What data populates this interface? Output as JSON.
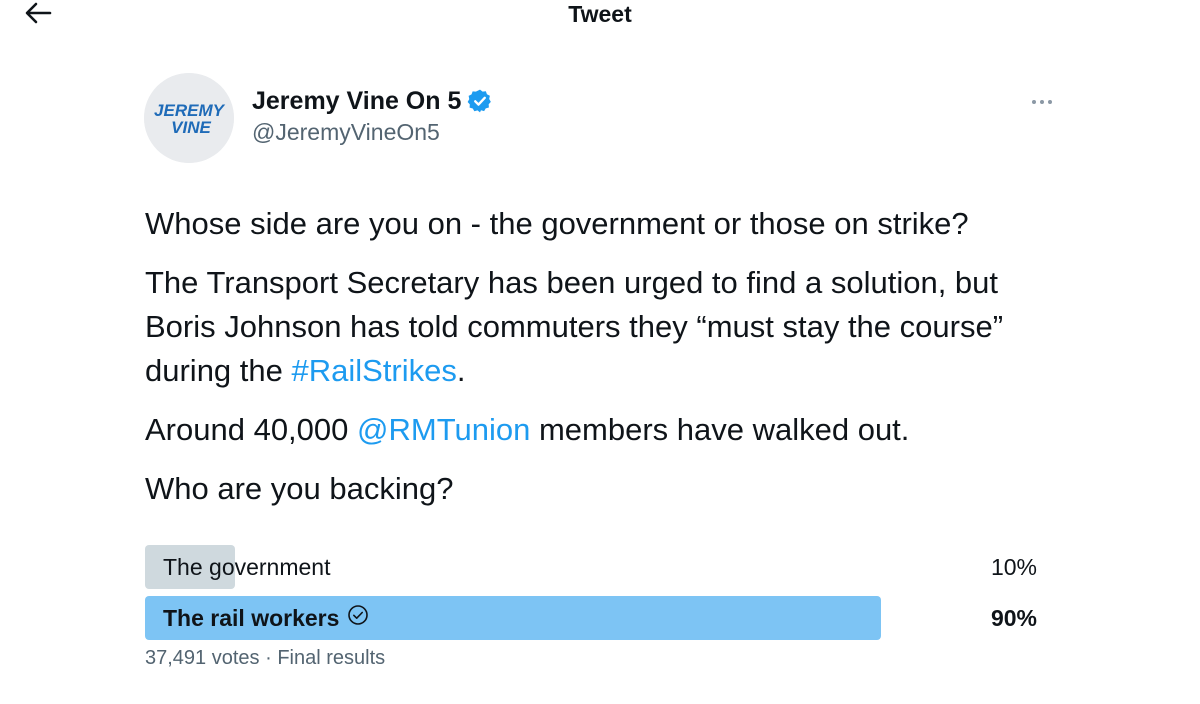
{
  "header": {
    "title": "Tweet"
  },
  "author": {
    "display_name": "Jeremy Vine On 5",
    "handle": "@JeremyVineOn5",
    "avatar_text_line1": "JEREMY",
    "avatar_text_line2": "VINE",
    "verified": true,
    "verified_color": "#1d9bf0"
  },
  "tweet": {
    "p1": "Whose side are you on - the government or those on strike?",
    "p2_pre": "The Transport Secretary has been urged to find a solution, but Boris Johnson has told commuters they “must stay the course” during the ",
    "p2_link": "#RailStrikes",
    "p2_post": ".",
    "p3_pre": "Around 40,000 ",
    "p3_link": "@RMTunion",
    "p3_post": " members have walked out.",
    "p4": "Who are you backing?"
  },
  "poll": {
    "options": [
      {
        "label": "The government",
        "percent_text": "10%",
        "percent": 10,
        "winner": false
      },
      {
        "label": "The rail workers",
        "percent_text": "90%",
        "percent": 90,
        "winner": true
      }
    ],
    "votes": "37,491 votes",
    "separator": "·",
    "status": "Final results"
  },
  "colors": {
    "link": "#1d9bf0",
    "bar_loser": "#cfd9de",
    "bar_winner": "#7dc4f4",
    "muted_text": "#536471"
  },
  "icons": {
    "back": "arrow-left-icon",
    "more": "more-horizontal-icon",
    "verified": "verified-badge-icon",
    "winner": "check-circle-icon"
  }
}
